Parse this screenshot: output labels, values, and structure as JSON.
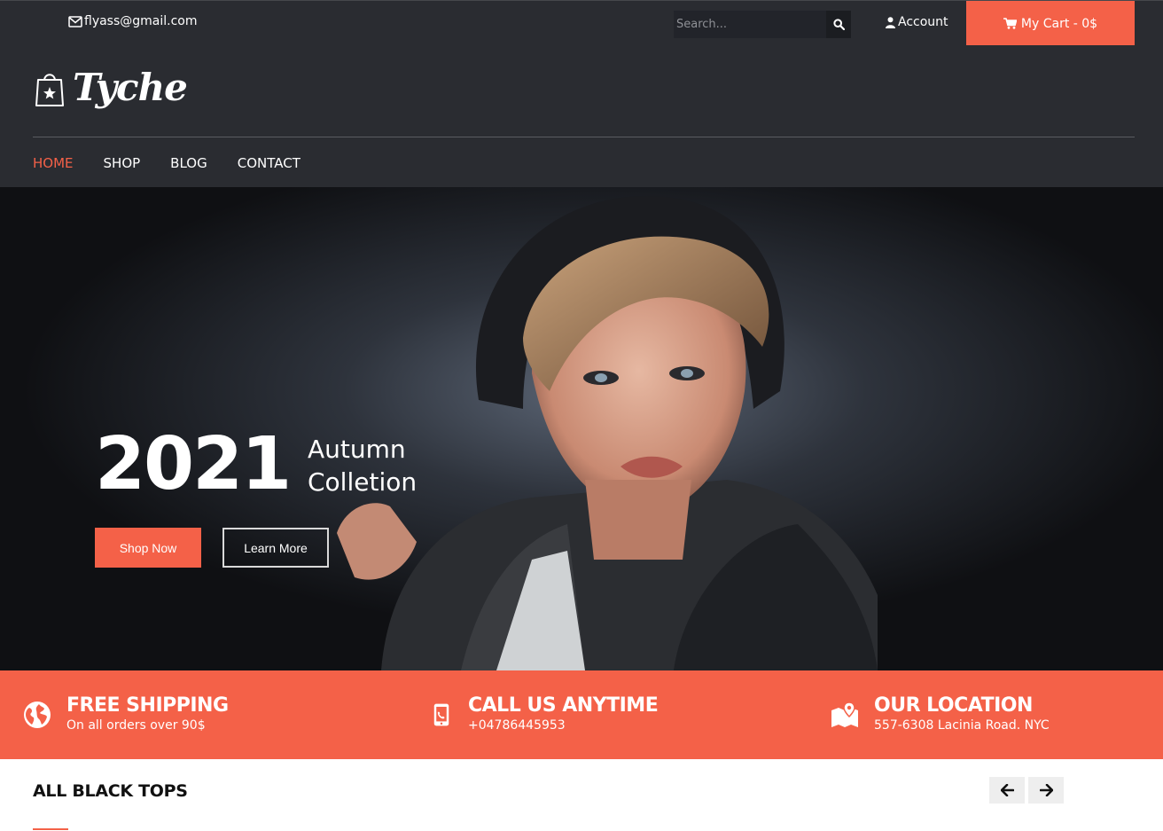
{
  "topbar": {
    "email": "flyass@gmail.com",
    "search_placeholder": "Search...",
    "account_label": "Account",
    "cart_label": "My Cart - 0$"
  },
  "header": {
    "logo_text": "Tyche",
    "nav": [
      {
        "label": "HOME",
        "active": true
      },
      {
        "label": "SHOP",
        "active": false
      },
      {
        "label": "BLOG",
        "active": false
      },
      {
        "label": "CONTACT",
        "active": false
      }
    ]
  },
  "hero": {
    "year": "2021",
    "season_line1": "Autumn",
    "season_line2": "Colletion",
    "shop_button": "Shop Now",
    "learn_button": "Learn More"
  },
  "features": [
    {
      "icon": "globe-icon",
      "title": "FREE SHIPPING",
      "subtitle": "On all orders over 90$"
    },
    {
      "icon": "phone-icon",
      "title": "CALL US ANYTIME",
      "subtitle": "+04786445953"
    },
    {
      "icon": "map-icon",
      "title": "OUR LOCATION",
      "subtitle": "557-6308 Lacinia Road. NYC"
    }
  ],
  "section": {
    "title": "ALL BLACK TOPS"
  },
  "colors": {
    "accent": "#f46148",
    "header_bg": "#2a2c31",
    "hero_bg": "#0f1013"
  }
}
